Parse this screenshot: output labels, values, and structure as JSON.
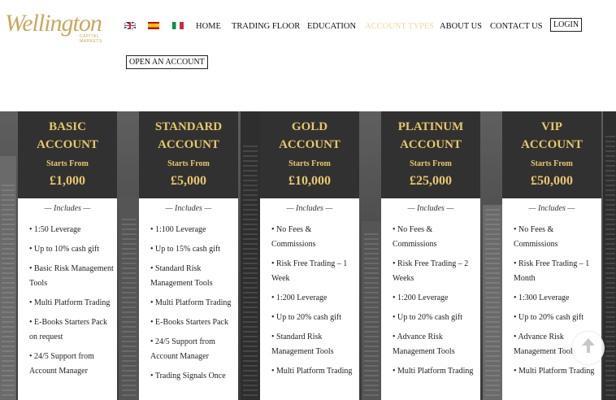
{
  "header": {
    "logo_text": "Wellington",
    "logo_sub": "CAPITAL MARKETS",
    "flags": [
      "flag-uk-icon",
      "flag-es-icon",
      "flag-it-icon"
    ],
    "nav": {
      "home": "HOME",
      "trading_floor": "TRADING FLOOR",
      "education": "EDUCATION",
      "account_types": "ACCOUNT TYPES",
      "about_us": "ABOUT US",
      "contact_us": "CONTACT US",
      "login": "LOGIN",
      "open_account": "OPEN AN ACCOUNT"
    },
    "active_nav": "account_types",
    "colors": {
      "gold": "#e8c76a",
      "logo_gold": "#c9a85c",
      "active_nav": "#efd9a0",
      "card_header": "#313131"
    }
  },
  "cards": [
    {
      "title_line1": "BASIC",
      "title_line2": "ACCOUNT",
      "starts_from": "Starts From",
      "price": "£1,000",
      "includes": "— Includes —",
      "features": [
        "• 1:50 Leverage",
        "• Up to 10% cash gift",
        "• Basic Risk Management  Tools",
        "• Multi Platform Trading",
        "• E-Books Starters Pack on request",
        "• 24/5 Support from Account Manager"
      ]
    },
    {
      "title_line1": "STANDARD",
      "title_line2": "ACCOUNT",
      "starts_from": "Starts From",
      "price": "£5,000",
      "includes": "— Includes —",
      "features": [
        "• 1:100 Leverage",
        "• Up to 15% cash gift",
        "• Standard Risk Management Tools",
        "• Multi Platform Trading",
        "• E-Books Starters Pack",
        "• 24/5 Support from Account Manager",
        "• Trading Signals Once"
      ]
    },
    {
      "title_line1": "GOLD",
      "title_line2": "ACCOUNT",
      "starts_from": "Starts From",
      "price": "£10,000",
      "includes": "— Includes —",
      "features": [
        "• No Fees & Commissions",
        "• Risk Free Trading – 1 Week",
        "• 1:200 Leverage",
        "• Up to 20% cash gift",
        "• Standard Risk Management Tools",
        "• Multi Platform Trading"
      ]
    },
    {
      "title_line1": "PLATINUM",
      "title_line2": "ACCOUNT",
      "starts_from": "Starts From",
      "price": "£25,000",
      "includes": "— Includes —",
      "features": [
        "• No Fees & Commissions",
        "• Risk Free Trading – 2 Weeks",
        "• 1:200 Leverage",
        "• Up to 20% cash gift",
        "• Advance Risk Management Tools",
        "• Multi Platform Trading"
      ]
    },
    {
      "title_line1": "VIP",
      "title_line2": "ACCOUNT",
      "starts_from": "Starts From",
      "price": "£50,000",
      "includes": "— Includes —",
      "features": [
        "• No Fees & Commissions",
        "• Risk Free Trading – 1 Month",
        "• 1:300 Leverage",
        "• Up to 20% cash gift",
        "• Advance Risk Management Tools",
        "• Multi Platform Trading"
      ]
    }
  ],
  "scroll_top_icon": "arrow-up-icon"
}
